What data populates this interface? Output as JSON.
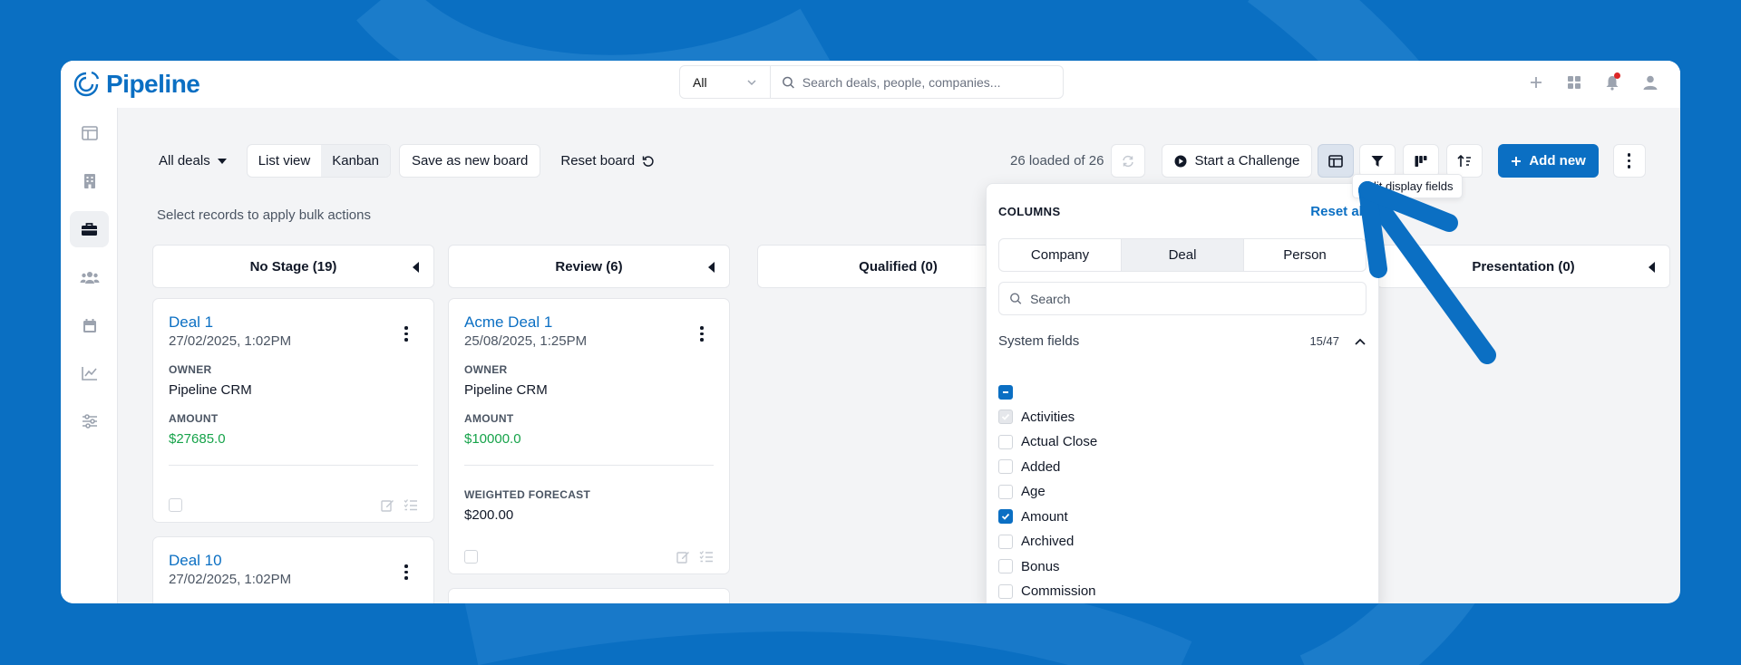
{
  "colors": {
    "brand": "#0b6fc3",
    "amount_green": "#16a34a",
    "background": "#0a6fc2"
  },
  "header": {
    "logo_text": "Pipeline",
    "search_scope": "All",
    "search_placeholder": "Search deals, people, companies..."
  },
  "header_icons": [
    "plus-icon",
    "apps-grid-icon",
    "bell-icon",
    "user-icon"
  ],
  "sidebar": [
    "board-icon",
    "building-icon",
    "briefcase-icon",
    "people-icon",
    "calendar-icon",
    "chart-icon",
    "settings-sliders-icon"
  ],
  "toolbar": {
    "all_deals": "All deals",
    "list_view": "List view",
    "kanban": "Kanban",
    "save_board": "Save as new board",
    "reset_board": "Reset board",
    "loaded": "26 loaded of 26",
    "challenge": "Start a Challenge",
    "add_new": "Add new"
  },
  "tooltip": "Edit display fields",
  "bulk_hint": "Select records to apply bulk actions",
  "columns": [
    {
      "name": "No Stage (19)"
    },
    {
      "name": "Review (6)"
    },
    {
      "name": "Qualified (0)"
    },
    {
      "name": "Presentation (0)"
    }
  ],
  "cards": {
    "c1": {
      "title": "Deal 1",
      "date": "27/02/2025, 1:02PM",
      "owner_label": "OWNER",
      "owner": "Pipeline CRM",
      "amount_label": "AMOUNT",
      "amount": "$27685.0"
    },
    "c2": {
      "title": "Deal 10",
      "date": "27/02/2025, 1:02PM"
    },
    "c3": {
      "title": "Acme Deal 1",
      "date": "25/08/2025, 1:25PM",
      "owner_label": "OWNER",
      "owner": "Pipeline CRM",
      "amount_label": "AMOUNT",
      "amount": "$10000.0",
      "forecast_label": "WEIGHTED FORECAST",
      "forecast": "$200.00"
    }
  },
  "panel": {
    "title": "COLUMNS",
    "reset": "Reset all",
    "tabs": [
      "Company",
      "Deal",
      "Person"
    ],
    "selected_tab": "Deal",
    "search_placeholder": "Search",
    "section": "System fields",
    "section_count": "15/47",
    "fields": [
      {
        "label": "Activities",
        "state": "disabled-checked"
      },
      {
        "label": "Actual Close",
        "state": "unchecked"
      },
      {
        "label": "Added",
        "state": "unchecked"
      },
      {
        "label": "Age",
        "state": "unchecked"
      },
      {
        "label": "Amount",
        "state": "checked"
      },
      {
        "label": "Archived",
        "state": "unchecked"
      },
      {
        "label": "Bonus",
        "state": "unchecked"
      },
      {
        "label": "Commission",
        "state": "unchecked"
      }
    ]
  }
}
